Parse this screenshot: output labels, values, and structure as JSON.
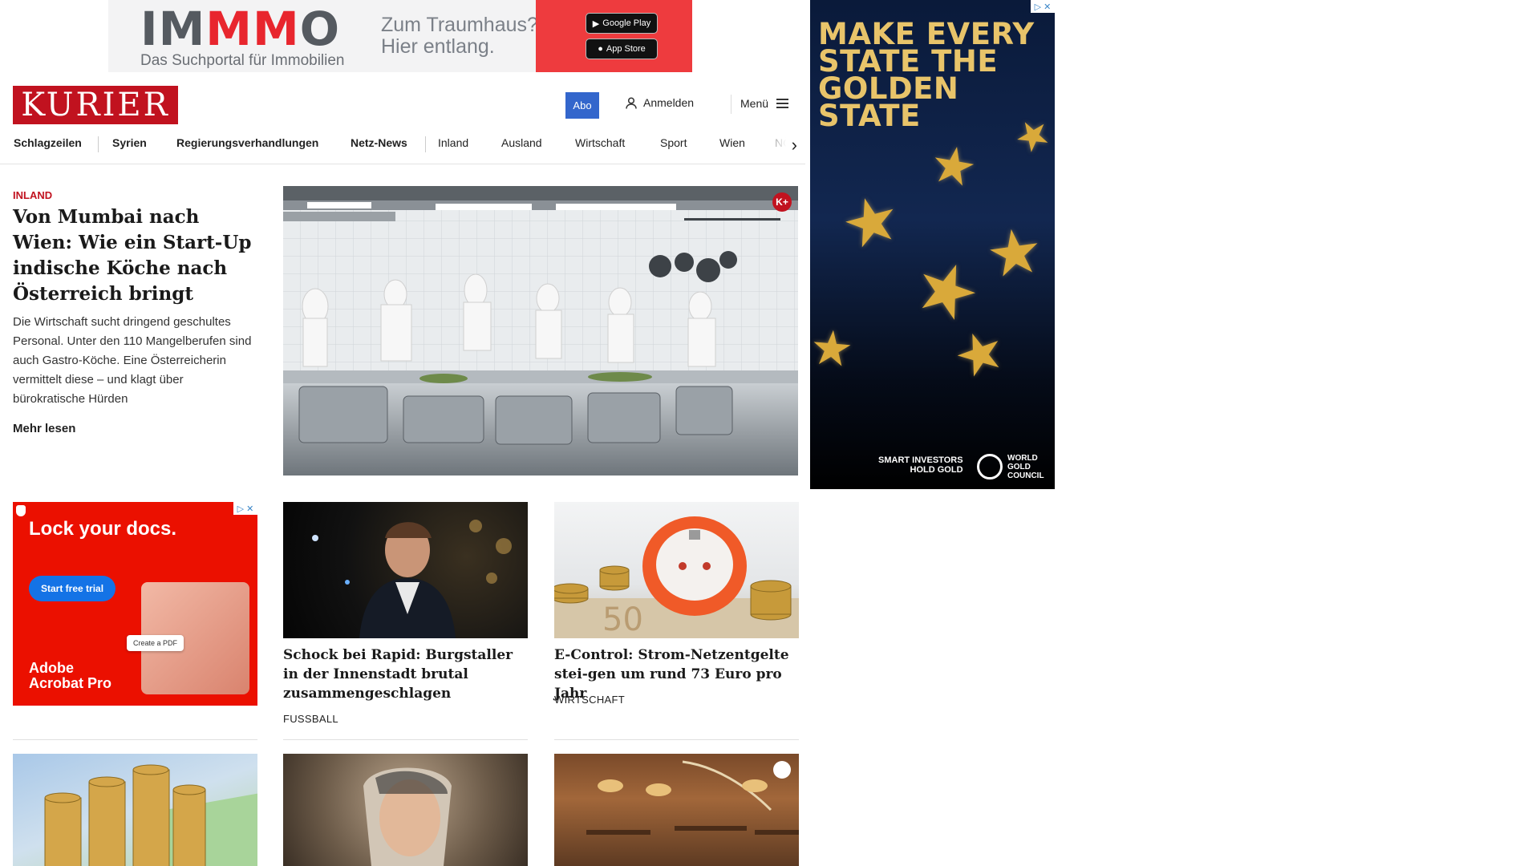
{
  "top_ad": {
    "logo_pre": "IM",
    "logo_mm": "MM",
    "logo_post": "O",
    "tagline_1": "Zum Traumhaus?",
    "tagline_2": "Hier entlang.",
    "subline": "Das Suchportal für Immobilien",
    "store_google": "Google Play",
    "store_apple": "App Store"
  },
  "header": {
    "brand": "KURIER",
    "abo": "Abo",
    "login": "Anmelden",
    "menu": "Menü"
  },
  "nav": {
    "items": [
      "Schlagzeilen",
      "Syrien",
      "Regierungsverhandlungen",
      "Netz-News",
      "Inland",
      "Ausland",
      "Wirtschaft",
      "Sport",
      "Wien",
      "NÖ"
    ]
  },
  "lead": {
    "kicker": "INLAND",
    "title": "Von Mumbai nach Wien: Wie ein Start-Up indische Köche nach Österreich bringt",
    "teaser": "Die Wirtschaft sucht dringend geschultes Personal. Unter den 110 Mangelberufen sind auch Gastro-Köche. Eine Österreicherin vermittelt diese – und klagt über bürokratische Hürden",
    "more": "Mehr lesen",
    "badge": "K+"
  },
  "sky_ad": {
    "title": "MAKE EVERY STATE THE GOLDEN STATE",
    "foot_1": "SMART INVESTORS",
    "foot_2": "HOLD GOLD",
    "logo_1": "WORLD",
    "logo_2": "GOLD",
    "logo_3": "COUNCIL"
  },
  "adobe_ad": {
    "headline": "Lock your docs.",
    "button": "Start free trial",
    "pdf": "Create a PDF",
    "brand_1": "Adobe",
    "brand_2": "Acrobat Pro"
  },
  "cards": [
    {
      "title": "Schock bei Rapid: Burgstaller in der Innenstadt brutal zusammengeschlagen",
      "category": "FUSSBALL"
    },
    {
      "title": "E-Control: Strom-Netzentgelte stei-gen um rund 73 Euro pro Jahr",
      "category": "WIRTSCHAFT"
    }
  ],
  "adchoices": "▷ ✕"
}
